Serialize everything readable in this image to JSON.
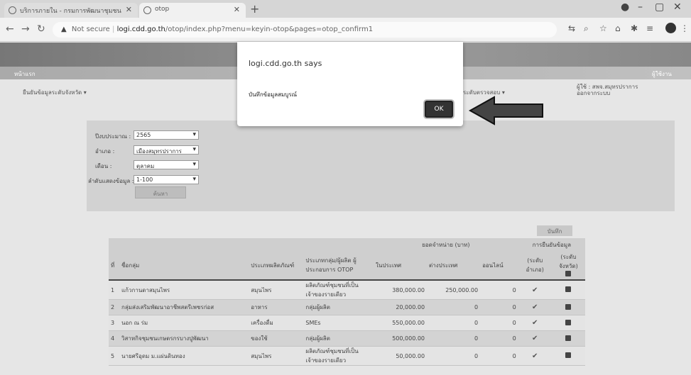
{
  "browser": {
    "tabs": [
      {
        "label": "บริการภายใน - กรมการพัฒนาชุมชน"
      },
      {
        "label": "otop"
      }
    ],
    "url_warning": "Not secure",
    "url_host": "logi.cdd.go.th",
    "url_path": "/otop/index.php?menu=keyin-otop&pages=otop_confirm1"
  },
  "page": {
    "banner_left": "หน้าแรก",
    "banner_right": "ผู้ใช้งาน",
    "nav_left": "ยืนยันข้อมูลระดับจังหวัด ▾",
    "nav_mid": "ระดับตรวจสอบ ▾",
    "user_info": "ผู้ใช้ : สพจ.สมุทรปราการ",
    "user_info2": "ออกจากระบบ"
  },
  "filters": {
    "year_label": "ปีงบประมาณ :",
    "year_value": "2565",
    "district_label": "อำเภอ :",
    "district_value": "เมืองสมุทรปราการ",
    "month_label": "เดือน :",
    "month_value": "ตุลาคม",
    "range_label": "ลำดับแสดงข้อมูล :",
    "range_value": "1-100",
    "search_button": "ค้นหา"
  },
  "save_button": "บันทึก",
  "table": {
    "sales_header": "ยอดจำหน่าย (บาท)",
    "confirm_header": "การยืนยันข้อมูล",
    "headers": [
      "ที่",
      "ชื่อกลุ่ม",
      "ประเภทผลิตภัณฑ์",
      "ประเภทกลุ่ม/ผู้ผลิต ผู้ประกอบการ OTOP",
      "ในประเทศ",
      "ต่างประเทศ",
      "ออนไลน์",
      "(ระดับ อำเภอ)",
      "(ระดับ จังหวัด)"
    ],
    "rows": [
      {
        "no": "1",
        "name": "แก้วกานดาสมุนไพร",
        "type": "สมุนไพร",
        "group": "ผลิตภัณฑ์ชุมชนที่เป็นเจ้าของรายเดียว",
        "domestic": "380,000.00",
        "foreign": "250,000.00",
        "online": "0"
      },
      {
        "no": "2",
        "name": "กลุ่มส่งเสริมพัฒนาอาชีพสตรีเพชรก่อส",
        "type": "อาหาร",
        "group": "กลุ่มผู้ผลิต",
        "domestic": "20,000.00",
        "foreign": "0",
        "online": "0"
      },
      {
        "no": "3",
        "name": "นอก ณ ร่ม",
        "type": "เครื่องดื่ม",
        "group": "SMEs",
        "domestic": "550,000.00",
        "foreign": "0",
        "online": "0"
      },
      {
        "no": "4",
        "name": "วิสาหกิจชุมชนเกษตรกรบางปูพัฒนา",
        "type": "ของใช้",
        "group": "กลุ่มผู้ผลิต",
        "domestic": "500,000.00",
        "foreign": "0",
        "online": "0"
      },
      {
        "no": "5",
        "name": "นายศรีอุดม ม.แผ่นดินทอง",
        "type": "สมุนไพร",
        "group": "ผลิตภัณฑ์ชุมชนที่เป็นเจ้าของรายเดียว",
        "domestic": "50,000.00",
        "foreign": "0",
        "online": "0"
      }
    ]
  },
  "dialog": {
    "title": "logi.cdd.go.th says",
    "message": "บันทึกข้อมูลสมบูรณ์",
    "ok": "OK"
  }
}
